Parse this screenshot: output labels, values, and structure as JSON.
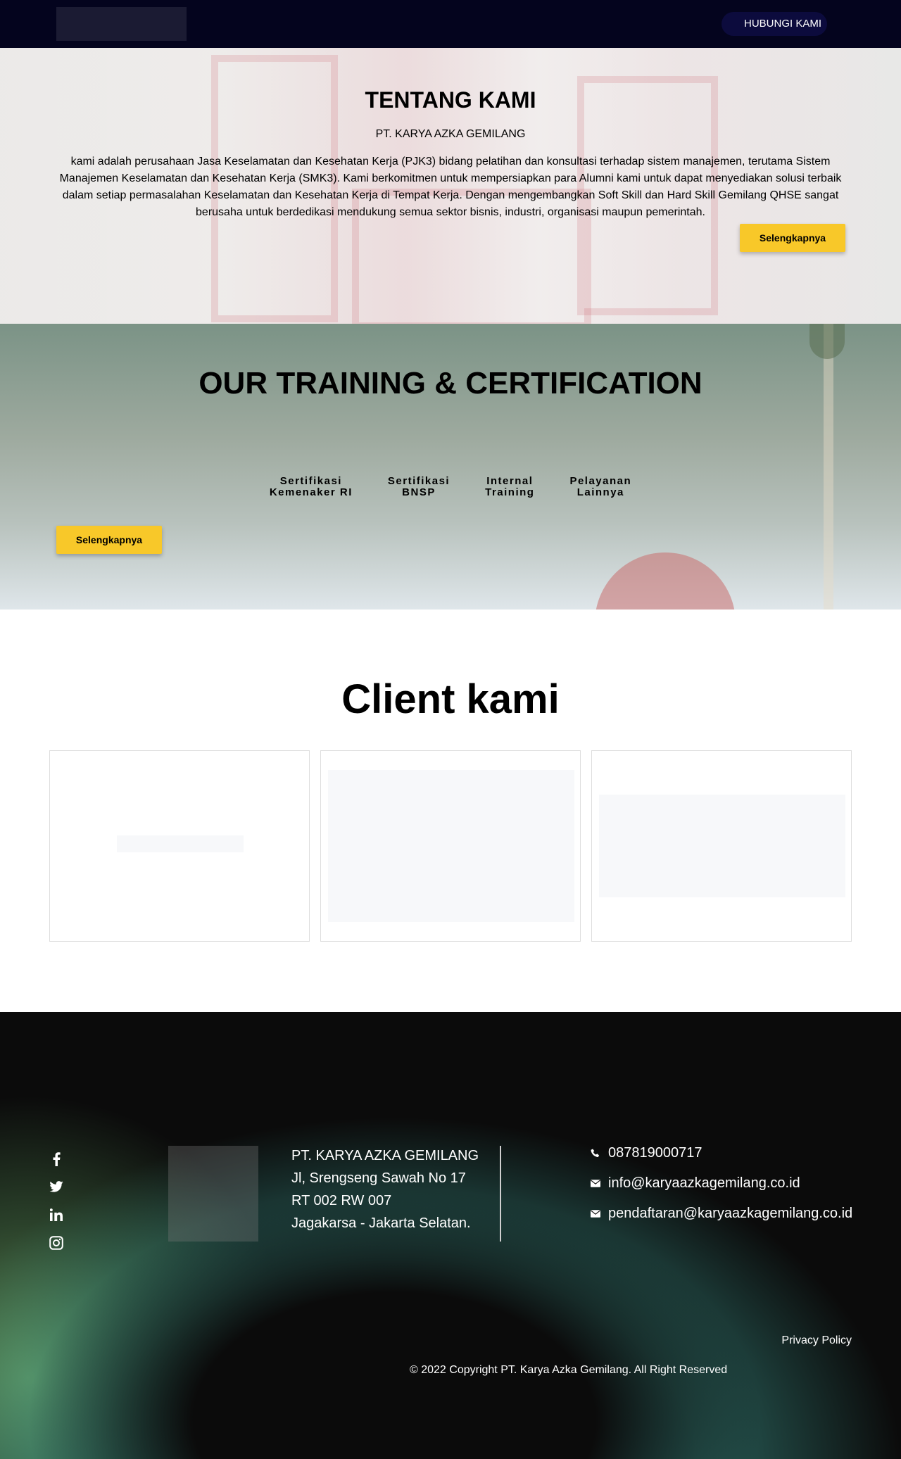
{
  "nav": {
    "contact_button": "HUBUNGI KAMI"
  },
  "about": {
    "title": "TENTANG KAMI",
    "company": "PT. KARYA AZKA GEMILANG",
    "description": "kami adalah perusahaan Jasa Keselamatan dan Kesehatan Kerja (PJK3) bidang pelatihan dan konsultasi terhadap sistem manajemen, terutama Sistem Manajemen Keselamatan dan Kesehatan Kerja (SMK3). Kami berkomitmen untuk mempersiapkan para Alumni kami untuk dapat menyediakan solusi terbaik dalam setiap permasalahan Keselamatan dan Kesehatan Kerja di Tempat Kerja. Dengan mengembangkan Soft Skill dan Hard Skill Gemilang QHSE sangat berusaha untuk berdedikasi mendukung semua sektor bisnis, industri, organisasi maupun pemerintah.",
    "button": "Selengkapnya"
  },
  "training": {
    "title": "OUR TRAINING & CERTIFICATION",
    "tabs": [
      {
        "line1": "Sertifikasi",
        "line2": "Kemenaker RI"
      },
      {
        "line1": "Sertifikasi",
        "line2": "BNSP"
      },
      {
        "line1": "Internal",
        "line2": "Training"
      },
      {
        "line1": "Pelayanan",
        "line2": "Lainnya"
      }
    ],
    "button": "Selengkapnya"
  },
  "clients": {
    "title": "Client kami"
  },
  "footer": {
    "social_icons": [
      "facebook-icon",
      "twitter-icon",
      "linkedin-icon",
      "instagram-icon"
    ],
    "address": {
      "line1": "PT. KARYA AZKA GEMILANG",
      "line2": "Jl, Srengseng Sawah No 17",
      "line3": "RT 002 RW 007",
      "line4": "Jagakarsa - Jakarta Selatan."
    },
    "contacts": {
      "phone": "087819000717",
      "email_info": "info@karyaazkagemilang.co.id",
      "email_registration": "pendaftaran@karyaazkagemilang.co.id"
    },
    "privacy": "Privacy Policy",
    "copyright": "© 2022  Copyright PT. Karya Azka Gemilang. All Right Reserved"
  },
  "colors": {
    "nav_bg": "#04041e",
    "accent_yellow": "#f8c829",
    "footer_bg": "#0b0b0b"
  }
}
